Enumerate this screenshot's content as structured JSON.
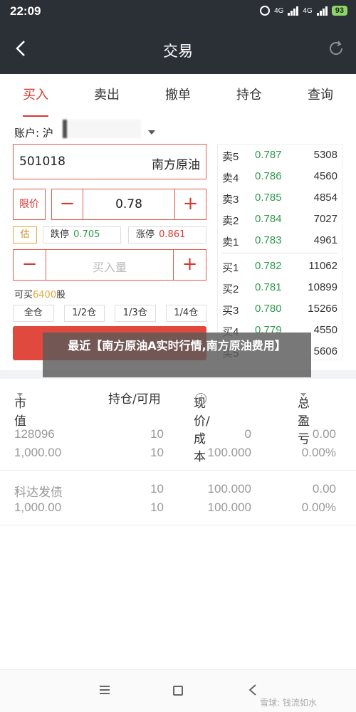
{
  "status": {
    "time": "22:09",
    "sig1": "4G",
    "sig2": "4G",
    "battery": "93"
  },
  "nav": {
    "title": "交易"
  },
  "tabs": [
    {
      "label": "买入",
      "active": true
    },
    {
      "label": "卖出"
    },
    {
      "label": "撤单"
    },
    {
      "label": "持仓"
    },
    {
      "label": "查询"
    }
  ],
  "form": {
    "account_label": "账户: 沪",
    "code": "501018",
    "name": "南方原油",
    "limit_label": "限价",
    "price": "0.78",
    "est_label": "估",
    "down_label": "跌停",
    "down_value": "0.705",
    "up_label": "涨停",
    "up_value": "0.861",
    "qty_placeholder": "买入量",
    "can_buy_prefix": "可买",
    "can_buy_num": "6400",
    "can_buy_suffix": "股",
    "fractions": [
      "全仓",
      "1/2仓",
      "1/3仓",
      "1/4仓"
    ]
  },
  "book": [
    {
      "label": "卖5",
      "price": "0.787",
      "vol": "5308"
    },
    {
      "label": "卖4",
      "price": "0.786",
      "vol": "4560"
    },
    {
      "label": "卖3",
      "price": "0.785",
      "vol": "4854"
    },
    {
      "label": "卖2",
      "price": "0.784",
      "vol": "7027"
    },
    {
      "label": "卖1",
      "price": "0.783",
      "vol": "4961"
    },
    {
      "label": "买1",
      "price": "0.782",
      "vol": "11062"
    },
    {
      "label": "买2",
      "price": "0.781",
      "vol": "10899"
    },
    {
      "label": "买3",
      "price": "0.780",
      "vol": "15266"
    },
    {
      "label": "买4",
      "price": "0.779",
      "vol": "4550"
    },
    {
      "label": "买5",
      "price": "",
      "vol": "5606"
    }
  ],
  "overlay_text": "最近【南方原油A实时行情,南方原油费用】",
  "table": {
    "headers": {
      "market_value": "市值",
      "holding": "持仓/可用",
      "price_cost": "现价/成本",
      "info": "i",
      "pnl": "总盈亏"
    },
    "rows": [
      {
        "c1a": "128096",
        "c1b": "1,000.00",
        "c2a": "10",
        "c2b": "10",
        "c3a": "0",
        "c3b": "100.000",
        "c4a": "0.00",
        "c4b": "0.00%"
      },
      {
        "c1a": "科达发债",
        "c1b": "1,000.00",
        "c2a": "10",
        "c2b": "10",
        "c3a": "100.000",
        "c3b": "100.000",
        "c4a": "0.00",
        "c4b": "0.00%"
      }
    ]
  },
  "watermark": "雪球: 钱流如水",
  "colors": {
    "accent": "#d8392f",
    "green": "#2f9a4c",
    "dark": "#2b2f36"
  }
}
